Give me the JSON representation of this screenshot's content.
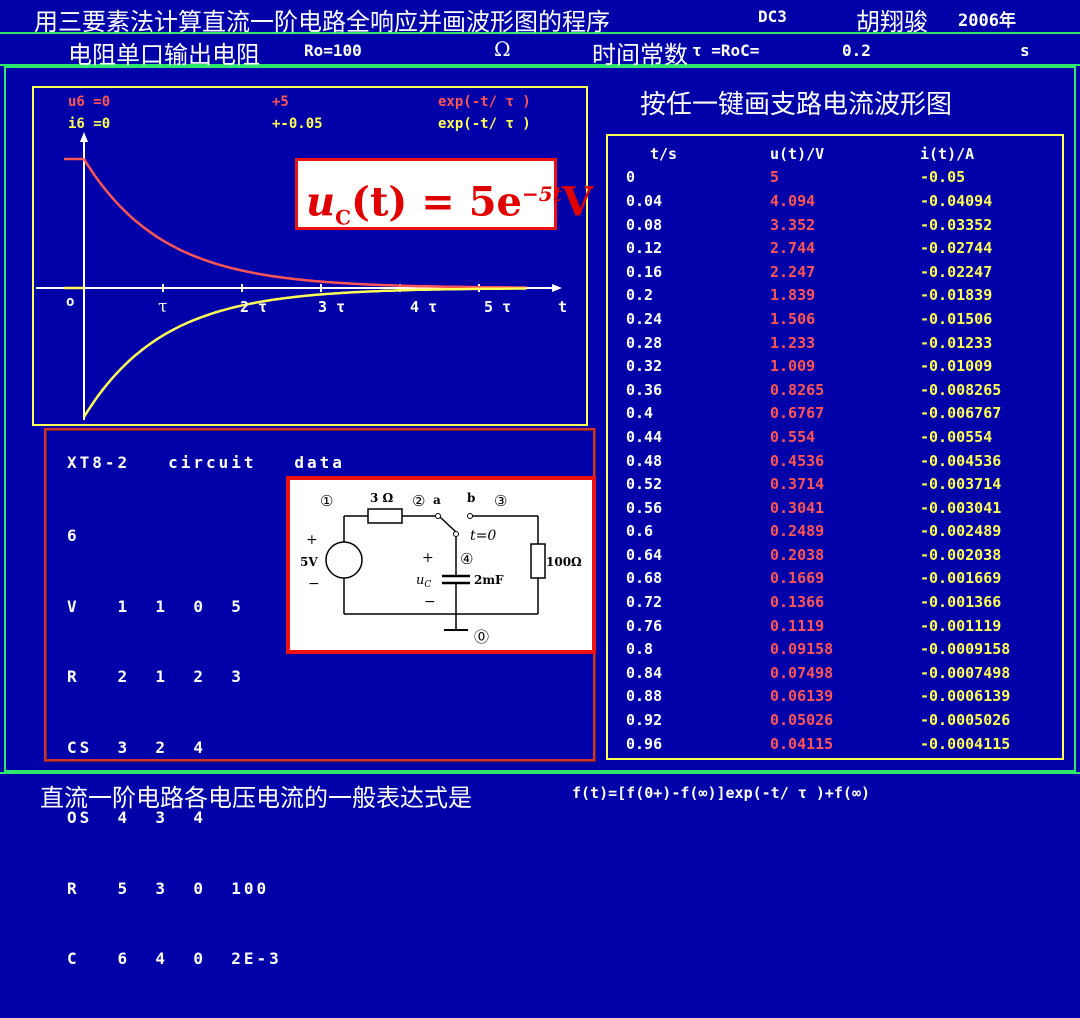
{
  "header": {
    "title": "用三要素法计算直流一阶电路全响应并画波形图的程序",
    "program_code": "DC3",
    "author": "胡翔骏",
    "year": "2006年"
  },
  "params": {
    "ro_label": "电阻单口输出电阻",
    "ro_value": "Ro=100",
    "ohm_symbol": "Ω",
    "tau_label": "时间常数",
    "tau_value": "τ =RoC=",
    "tau_num": "0.2",
    "tau_unit": "s"
  },
  "plot": {
    "u_line": {
      "name": "u6 =0",
      "amp": "+5",
      "expr": "exp(-t/ τ )"
    },
    "i_line": {
      "name": "i6 =0",
      "amp": "+-0.05",
      "expr": "exp(-t/ τ )"
    },
    "origin": "o",
    "ticks": [
      "τ",
      "2 τ",
      "3 τ",
      "4 τ",
      "5 τ"
    ],
    "x_label": "t",
    "colors": {
      "u": "#ff5555",
      "i": "#ffff55",
      "axis": "#ffffff"
    }
  },
  "chart_data": {
    "type": "line",
    "series": [
      {
        "name": "u6",
        "values": [
          5,
          4.094,
          3.352,
          2.744,
          2.247,
          1.839,
          1.506,
          1.233,
          1.009,
          0.8265,
          0.6767,
          0.554,
          0.4536,
          0.3714,
          0.3041,
          0.2489,
          0.2038,
          0.1669,
          0.1366,
          0.1119,
          0.09158,
          0.07498,
          0.06139,
          0.05026,
          0.04115
        ]
      },
      {
        "name": "i6",
        "values": [
          -0.05,
          -0.04094,
          -0.03352,
          -0.02744,
          -0.02247,
          -0.01839,
          -0.01506,
          -0.01233,
          -0.01009,
          -0.008265,
          -0.006767,
          -0.00554,
          -0.004536,
          -0.003714,
          -0.003041,
          -0.002489,
          -0.002038,
          -0.001669,
          -0.001366,
          -0.001119,
          -0.0009158,
          -0.0007498,
          -0.0006139,
          -0.0005026,
          -0.0004115
        ]
      }
    ],
    "x": [
      0,
      0.04,
      0.08,
      0.12,
      0.16,
      0.2,
      0.24,
      0.28,
      0.32,
      0.36,
      0.4,
      0.44,
      0.48,
      0.52,
      0.56,
      0.6,
      0.64,
      0.68,
      0.72,
      0.76,
      0.8,
      0.84,
      0.88,
      0.92,
      0.96
    ],
    "xlabel": "t",
    "x_tick_labels": [
      "τ",
      "2 τ",
      "3 τ",
      "4 τ",
      "5 τ"
    ],
    "tau": 0.2
  },
  "formula": {
    "u": "u",
    "sub": "C",
    "arg": "(t) = 5e",
    "exp": "−5t",
    "unit": "V"
  },
  "right_panel": {
    "prompt": "按任一键画支路电流波形图",
    "headers": [
      "t/s",
      "u(t)/V",
      "i(t)/A"
    ],
    "rows": [
      [
        "0",
        "5",
        "-0.05"
      ],
      [
        "0.04",
        "4.094",
        "-0.04094"
      ],
      [
        "0.08",
        "3.352",
        "-0.03352"
      ],
      [
        "0.12",
        "2.744",
        "-0.02744"
      ],
      [
        "0.16",
        "2.247",
        "-0.02247"
      ],
      [
        "0.2",
        "1.839",
        "-0.01839"
      ],
      [
        "0.24",
        "1.506",
        "-0.01506"
      ],
      [
        "0.28",
        "1.233",
        "-0.01233"
      ],
      [
        "0.32",
        "1.009",
        "-0.01009"
      ],
      [
        "0.36",
        "0.8265",
        "-0.008265"
      ],
      [
        "0.4",
        "0.6767",
        "-0.006767"
      ],
      [
        "0.44",
        "0.554",
        "-0.00554"
      ],
      [
        "0.48",
        "0.4536",
        "-0.004536"
      ],
      [
        "0.52",
        "0.3714",
        "-0.003714"
      ],
      [
        "0.56",
        "0.3041",
        "-0.003041"
      ],
      [
        "0.6",
        "0.2489",
        "-0.002489"
      ],
      [
        "0.64",
        "0.2038",
        "-0.002038"
      ],
      [
        "0.68",
        "0.1669",
        "-0.001669"
      ],
      [
        "0.72",
        "0.1366",
        "-0.001366"
      ],
      [
        "0.76",
        "0.1119",
        "-0.001119"
      ],
      [
        "0.8",
        "0.09158",
        "-0.0009158"
      ],
      [
        "0.84",
        "0.07498",
        "-0.0007498"
      ],
      [
        "0.88",
        "0.06139",
        "-0.0006139"
      ],
      [
        "0.92",
        "0.05026",
        "-0.0005026"
      ],
      [
        "0.96",
        "0.04115",
        "-0.0004115"
      ]
    ]
  },
  "circuit_data": {
    "title": "XT8-2   circuit   data",
    "lines": [
      "6",
      "V   1  1  0  5",
      "R   2  1  2  3",
      "CS  3  2  4",
      "OS  4  3  4",
      "R   5  3  0  100",
      "C   6  4  0  2E-3"
    ]
  },
  "schematic": {
    "node1": "①",
    "node2": "②",
    "node3": "③",
    "node4": "④",
    "node0": "⓪",
    "r1": "3 Ω",
    "a": "a",
    "b": "b",
    "switch": "t=0",
    "source": "5V",
    "plus": "+",
    "minus": "−",
    "uc": "u",
    "uc_sub": "C",
    "cap": "2mF",
    "rload": "100Ω"
  },
  "footer": {
    "text": "直流一阶电路各电压电流的一般表达式是",
    "formula": "f(t)=[f(0+)-f(∞)]exp(-t/ τ )+f(∞)"
  }
}
